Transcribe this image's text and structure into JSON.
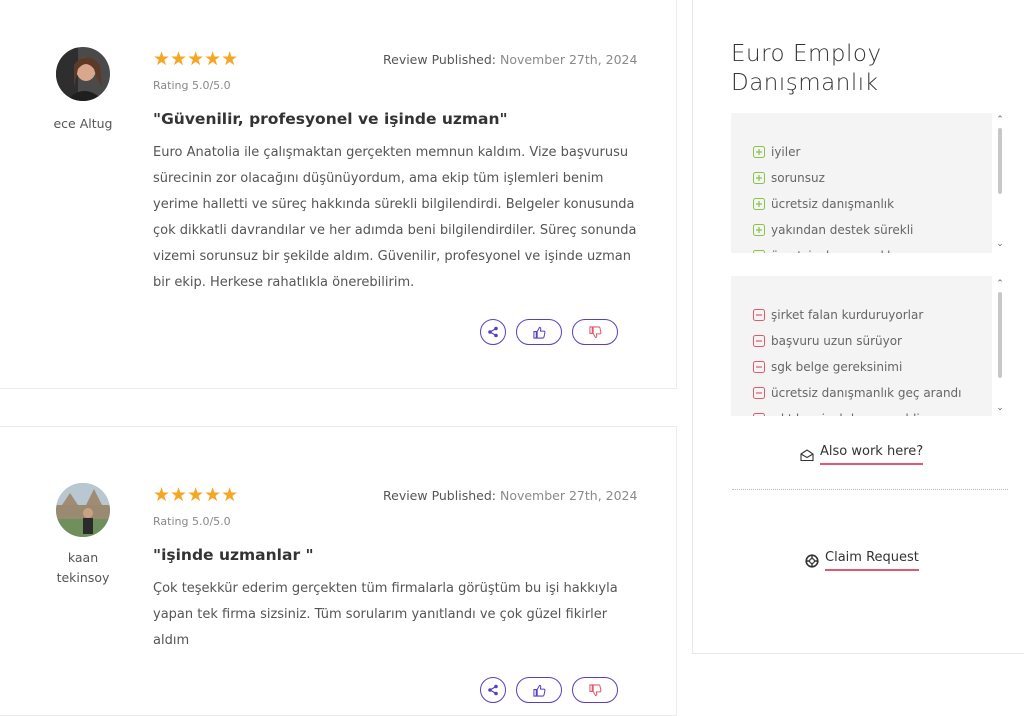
{
  "reviews": [
    {
      "name": "ece Altug",
      "stars": "★★★★★",
      "rating": "Rating 5.0/5.0",
      "published_label": "Review Published:",
      "published_date": "November 27th, 2024",
      "title": "\"Güvenilir, profesyonel ve işinde uzman\"",
      "body": "Euro Anatolia ile çalışmaktan gerçekten memnun kaldım. Vize başvurusu sürecinin zor olacağını düşünüyordum, ama ekip tüm işlemleri benim yerime halletti ve süreç hakkında sürekli bilgilendirdi. Belgeler konusunda çok dikkatli davrandılar ve her adımda beni bilgilendirdiler. Süreç sonunda vizemi sorunsuz bir şekilde aldım. Güvenilir, profesyonel ve işinde uzman bir ekip. Herkese rahatlıkla önerebilirim."
    },
    {
      "name": "kaan tekinsoy",
      "stars": "★★★★★",
      "rating": "Rating 5.0/5.0",
      "published_label": "Review Published:",
      "published_date": "November 27th, 2024",
      "title": "\"işinde uzmanlar \"",
      "body": "Çok teşekkür ederim gerçekten tüm firmalarla görüştüm bu işi hakkıyla yapan tek firma sizsiniz. Tüm sorularım yanıtlandı ve çok güzel fikirler aldım"
    }
  ],
  "sidebar": {
    "company_name": "Euro Employ Danışmanlık",
    "pros": [
      "iyiler",
      "sorunsuz",
      "ücretsiz danışmanlık",
      "yakından destek sürekli",
      "ücretsiz danışmanlık"
    ],
    "cons": [
      "şirket falan kurduruyorlar",
      "başvuru uzun sürüyor",
      "sgk belge gereksinimi",
      "ücretsiz danışmanlık geç arandı",
      "çıktılar siyah beyaz geldi"
    ],
    "also_work_label": "Also work here?",
    "claim_label": "Claim Request"
  },
  "colors": {
    "star": "#f5a623",
    "accent": "#5a3fc0",
    "pro": "#8bc34a",
    "con": "#e05a6f"
  }
}
